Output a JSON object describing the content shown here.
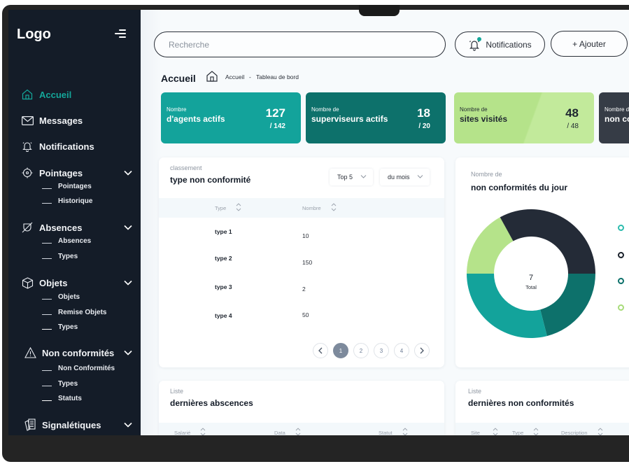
{
  "sidebar": {
    "logo": "Logo",
    "items": [
      {
        "label": "Accueil",
        "icon": "home-icon",
        "active": true
      },
      {
        "label": "Messages",
        "icon": "mail-icon"
      },
      {
        "label": "Notifications",
        "icon": "bell-icon"
      },
      {
        "label": "Pointages",
        "icon": "target-icon",
        "children": [
          "Pointages",
          "Historique"
        ]
      },
      {
        "label": "Absences",
        "icon": "absence-icon",
        "children": [
          "Absences",
          "Types"
        ]
      },
      {
        "label": "Objets",
        "icon": "box-icon",
        "children": [
          "Objets",
          "Remise Objets",
          "Types"
        ]
      },
      {
        "label": "Non conformités",
        "icon": "warning-icon",
        "children": [
          "Non Conformités",
          "Types",
          "Statuts"
        ]
      },
      {
        "label": "Signalétiques",
        "icon": "documents-icon"
      }
    ]
  },
  "header": {
    "search_placeholder": "Recherche",
    "notifications_label": "Notifications",
    "add_label": "+ Ajouter"
  },
  "page": {
    "title": "Accueil",
    "breadcrumb": [
      "Accueil",
      "-",
      "Tableau de bord"
    ]
  },
  "stats": [
    {
      "small": "Nombre",
      "big": "d'agents actifs",
      "value": "127",
      "total": "/ 142",
      "color": "#13a39b"
    },
    {
      "small": "Nombre de",
      "big": "superviseurs actifs",
      "value": "18",
      "total": "/ 20",
      "color": "#0d716b"
    },
    {
      "small": "Nombre de",
      "big": "sites visités",
      "value": "48",
      "total": "/ 48",
      "color": "#b5e38a"
    },
    {
      "small": "Nombre de",
      "big": "non conformités",
      "value": "",
      "total": "",
      "color": "#363c46"
    }
  ],
  "ranking": {
    "subtitle": "classement",
    "title": "type non conformité",
    "filter_top": "Top 5",
    "filter_period": "du mois",
    "columns": [
      "Type",
      "Nombre"
    ],
    "rows": [
      {
        "type": "type 1",
        "count": "10"
      },
      {
        "type": "type 2",
        "count": "150"
      },
      {
        "type": "type 3",
        "count": "2"
      },
      {
        "type": "type 4",
        "count": "50"
      }
    ],
    "pagination": {
      "pages": [
        "1",
        "2",
        "3",
        "4"
      ],
      "current": "1"
    }
  },
  "donut": {
    "subtitle": "Nombre de",
    "title": "non conformités du jour",
    "total_value": "7",
    "total_label": "Total"
  },
  "chart_data": {
    "type": "pie",
    "title": "non conformités du jour",
    "total": 7,
    "center_label": "Total",
    "series": [
      {
        "name": "segment-dark-teal",
        "share_percent": 21,
        "color": "#0d716b"
      },
      {
        "name": "segment-teal",
        "share_percent": 29,
        "color": "#13a39b"
      },
      {
        "name": "segment-light-green",
        "share_percent": 17,
        "color": "#b5e38a"
      },
      {
        "name": "segment-dark",
        "share_percent": 33,
        "color": "#242b37"
      }
    ],
    "legend_colors": [
      "#2dbcae",
      "#1b222c",
      "#0d716b",
      "#a8dc7a"
    ],
    "legend": "right"
  },
  "absences": {
    "subtitle": "Liste",
    "title": "dernières abscences",
    "columns": [
      "Salarié",
      "Data",
      "Statut"
    ]
  },
  "nonconformities": {
    "subtitle": "Liste",
    "title": "dernières non conformités",
    "columns": [
      "Site",
      "Type",
      "Description"
    ]
  }
}
